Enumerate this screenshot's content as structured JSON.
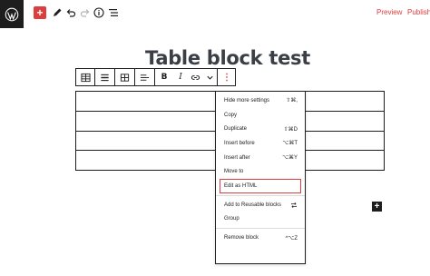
{
  "topbar": {
    "preview_label": "Preview",
    "publish_label": "Publish",
    "add_icon": "+",
    "accent_color": "#dc3d3d"
  },
  "post": {
    "title": "Table block test"
  },
  "block_toolbar": {
    "bold_label": "B",
    "italic_label": "I",
    "more_label": "⋮"
  },
  "table": {
    "rows": 4,
    "cols": 2
  },
  "dropdown": {
    "section1": [
      {
        "label": "Hide more settings",
        "shortcut": "⇧⌘,"
      },
      {
        "label": "Copy",
        "shortcut": ""
      },
      {
        "label": "Duplicate",
        "shortcut": "⇧⌘D"
      },
      {
        "label": "Insert before",
        "shortcut": "⌥⌘T"
      },
      {
        "label": "Insert after",
        "shortcut": "⌥⌘Y"
      },
      {
        "label": "Move to",
        "shortcut": ""
      },
      {
        "label": "Edit as HTML",
        "shortcut": ""
      }
    ],
    "section2": [
      {
        "label": "Add to Reusable blocks",
        "icon": "reusable-icon"
      },
      {
        "label": "Group",
        "shortcut": ""
      }
    ],
    "section3": [
      {
        "label": "Remove block",
        "shortcut": "^⌥Z"
      }
    ]
  },
  "inserter": {
    "label": "+"
  }
}
